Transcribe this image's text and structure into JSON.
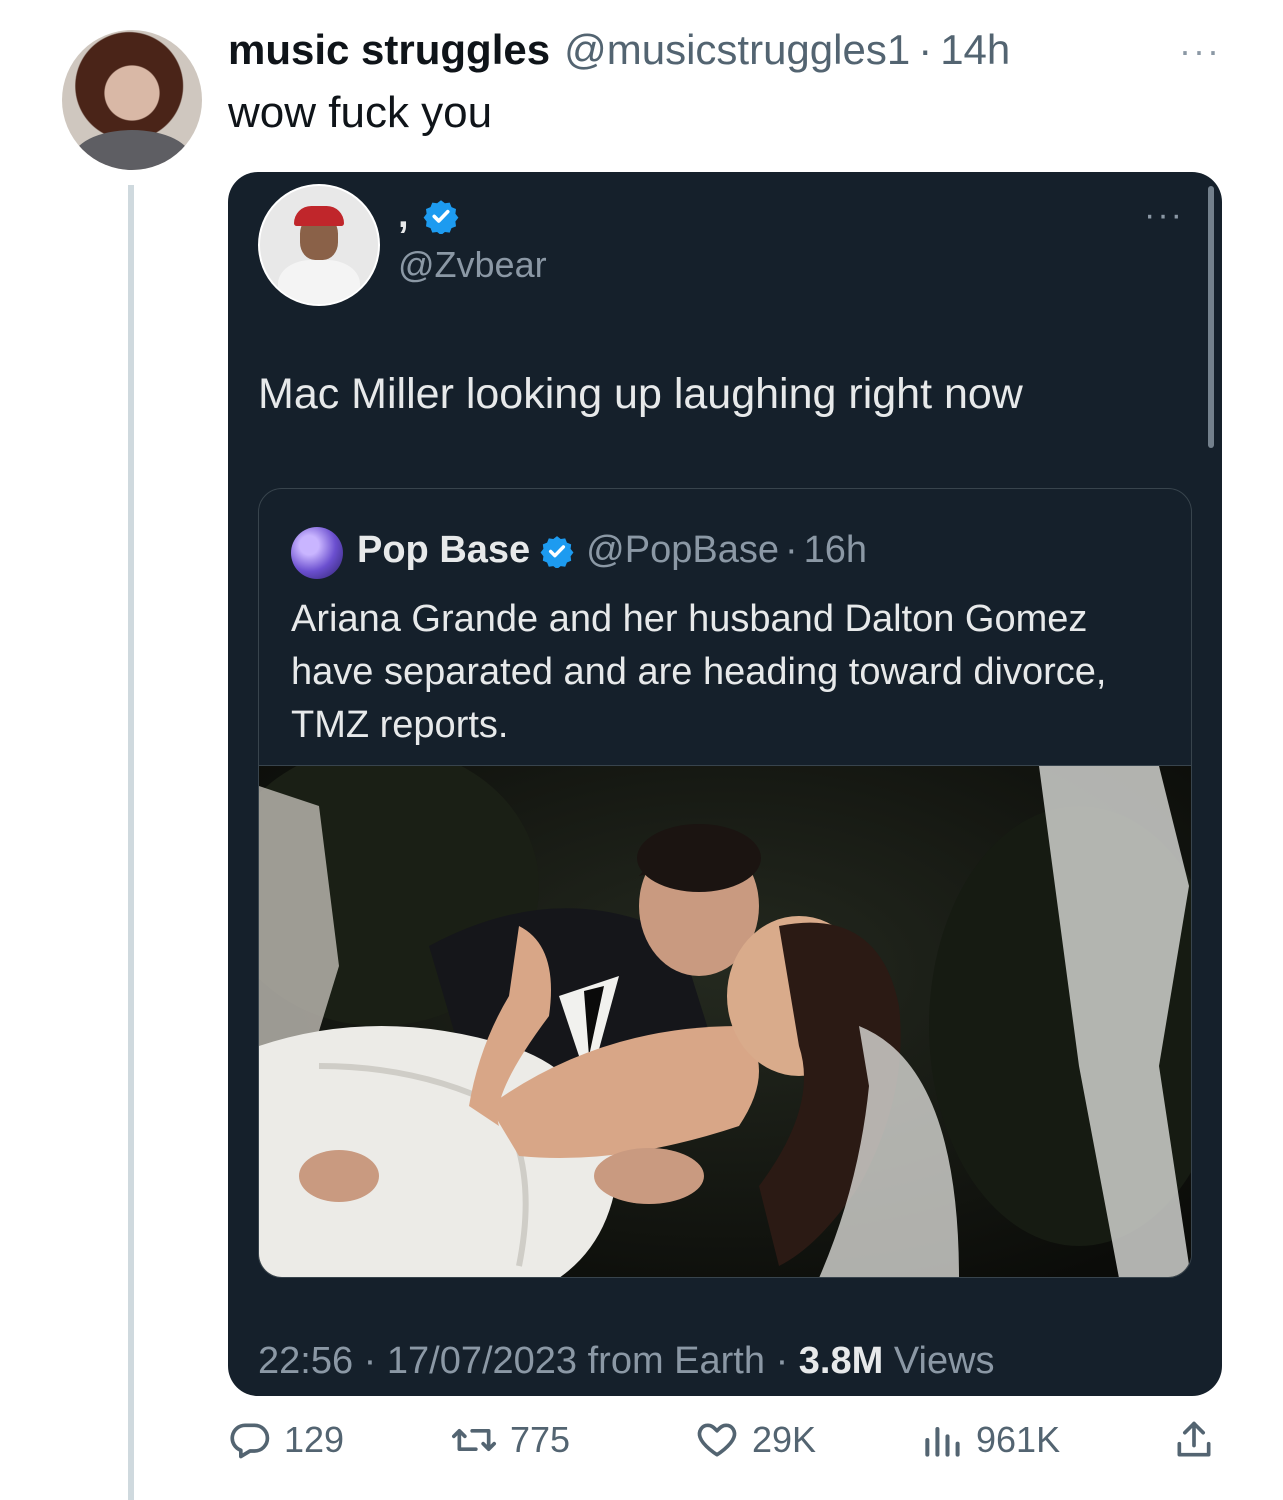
{
  "reply_tweet": {
    "display_name": "music struggles",
    "handle": "@musicstruggles1",
    "separator": "·",
    "time": "14h",
    "more": "···",
    "text": "wow fuck you"
  },
  "quoted_tweet": {
    "display_name": ",",
    "handle": "@Zvbear",
    "more": "···",
    "text": "Mac Miller looking up laughing right now",
    "embedded": {
      "display_name": "Pop Base",
      "handle": "@PopBase",
      "separator": "·",
      "time": "16h",
      "text": "Ariana Grande and her husband Dalton Gomez have separated and are heading toward divorce, TMZ reports."
    },
    "meta": {
      "time": "22:56",
      "sep1": " · ",
      "date": "17/07/2023",
      "source": " from Earth",
      "sep2": " · ",
      "views_count": "3.8M",
      "views_label": " Views"
    }
  },
  "actions": {
    "replies": "129",
    "retweets": "775",
    "likes": "29K",
    "views": "961K"
  },
  "colors": {
    "verified": "#1d9bf0",
    "card_bg": "#15202b",
    "muted": "#536471"
  }
}
